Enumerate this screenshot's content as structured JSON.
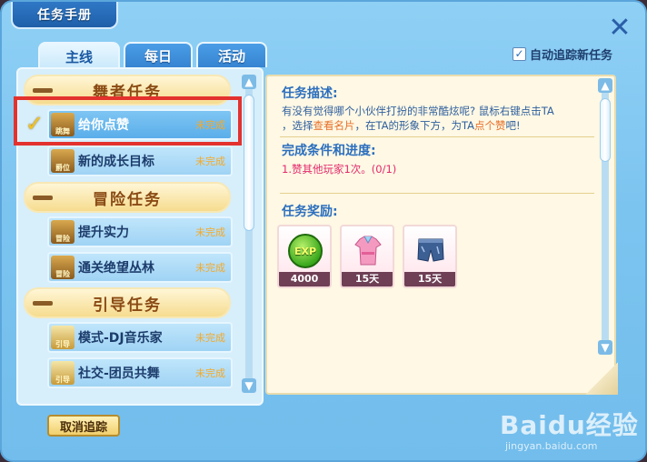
{
  "window": {
    "title": "任务手册"
  },
  "tabs": [
    {
      "label": "主线",
      "active": true
    },
    {
      "label": "每日",
      "active": false
    },
    {
      "label": "活动",
      "active": false
    }
  ],
  "auto_track": {
    "label": "自动追踪新任务",
    "checked": true
  },
  "categories": [
    {
      "label": "舞者任务",
      "quests": [
        {
          "icon": "dancer-badge-icon",
          "badge": "跳舞",
          "name": "给你点赞",
          "status": "未完成",
          "selected": true
        },
        {
          "icon": "crown-badge-icon",
          "badge": "爵位",
          "name": "新的成长目标",
          "status": "未完成",
          "selected": false
        }
      ]
    },
    {
      "label": "冒险任务",
      "quests": [
        {
          "icon": "adventure-chest-icon",
          "badge": "冒险",
          "name": "提升实力",
          "status": "未完成",
          "selected": false
        },
        {
          "icon": "adventure-chest-icon",
          "badge": "冒险",
          "name": "通关绝望丛林",
          "status": "未完成",
          "selected": false
        }
      ]
    },
    {
      "label": "引导任务",
      "quests": [
        {
          "icon": "guide-bulb-icon",
          "badge": "引导",
          "name": "模式-DJ音乐家",
          "status": "未完成",
          "selected": false
        },
        {
          "icon": "guide-bulb-icon",
          "badge": "引导",
          "name": "社交-团员共舞",
          "status": "未完成",
          "selected": false
        }
      ]
    }
  ],
  "details": {
    "description_title": "任务描述:",
    "description_line1": "有没有觉得哪个小伙伴打扮的非常酷炫呢? 鼠标右键点击TA",
    "description_line2_pre": "，选择",
    "description_line2_hl1": "查看名片",
    "description_line2_mid": "，在TA的形象下方，为TA",
    "description_line2_hl2": "点个赞",
    "description_line2_post": "吧!",
    "progress_title": "完成条件和进度:",
    "progress_text": "1.赞其他玩家1次。(0/1)",
    "reward_title": "任务奖励:",
    "rewards": [
      {
        "icon": "exp-orb-icon",
        "art_text": "EXP",
        "label": "4000"
      },
      {
        "icon": "pink-top-icon",
        "art_text": "",
        "label": "15天"
      },
      {
        "icon": "denim-shorts-icon",
        "art_text": "",
        "label": "15天"
      }
    ]
  },
  "buttons": {
    "cancel_track": "取消追踪",
    "close": "✕"
  },
  "watermark": {
    "brand": "Baidu经验",
    "url": "jingyan.baidu.com"
  }
}
